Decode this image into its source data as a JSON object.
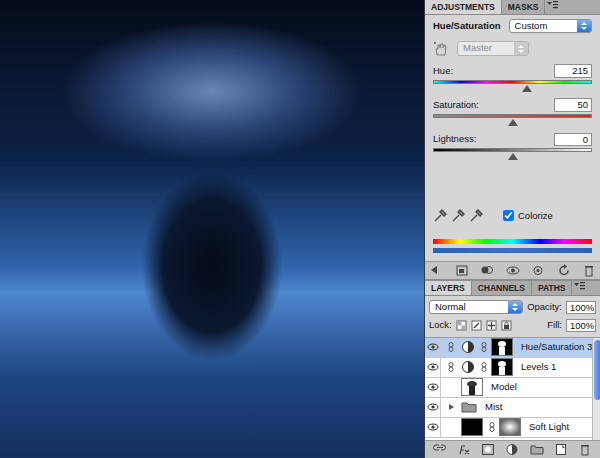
{
  "canvas": {
    "kind": "photo"
  },
  "adjustments_panel": {
    "tabs": [
      {
        "label": "ADJUSTMENTS",
        "selected": true
      },
      {
        "label": "MASKS",
        "selected": false
      }
    ],
    "title": "Hue/Saturation",
    "preset": "Custom",
    "channel": {
      "value": "Master",
      "disabled": true
    },
    "sliders": [
      {
        "label": "Hue:",
        "value": "215",
        "level": 0.59,
        "kind": "hue"
      },
      {
        "label": "Saturation:",
        "value": "50",
        "level": 0.5,
        "kind": "saturation"
      },
      {
        "label": "Lightness:",
        "value": "0",
        "level": 0.5,
        "kind": "lightness"
      }
    ],
    "colorize": {
      "label": "Colorize",
      "checked": true
    }
  },
  "layers_panel": {
    "tabs": [
      {
        "label": "LAYERS",
        "selected": true
      },
      {
        "label": "CHANNELS",
        "selected": false
      },
      {
        "label": "PATHS",
        "selected": false
      }
    ],
    "blend_mode": "Normal",
    "opacity_label": "Opacity:",
    "opacity": "100%",
    "lock_label": "Lock:",
    "fill_label": "Fill:",
    "fill": "100%",
    "layers": [
      {
        "name": "Hue/Saturation 3",
        "kind": "adjustment",
        "selected": true,
        "visible": true
      },
      {
        "name": "Levels 1",
        "kind": "adjustment",
        "selected": false,
        "visible": true
      },
      {
        "name": "Model",
        "kind": "pixel",
        "selected": false,
        "visible": true
      },
      {
        "name": "Mist",
        "kind": "group",
        "selected": false,
        "visible": true,
        "expanded": false
      },
      {
        "name": "Soft Light",
        "kind": "masked",
        "selected": false,
        "visible": true
      }
    ]
  }
}
